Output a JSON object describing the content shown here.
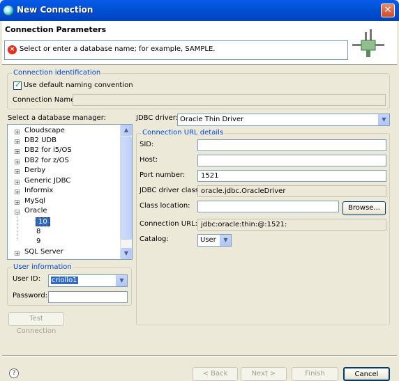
{
  "window": {
    "title": "New Connection",
    "close_glyph": "✕"
  },
  "header": {
    "title": "Connection Parameters",
    "message": "Select or enter a database name; for example, SAMPLE.",
    "message_icon": "error-icon"
  },
  "connection_identification": {
    "legend": "Connection identification",
    "use_default_label": "Use default naming convention",
    "use_default_checked": true,
    "name_label": "Connection Name:",
    "name_value": ""
  },
  "db_manager": {
    "label": "Select a database manager:",
    "items": [
      {
        "label": "Cloudscape",
        "expander": "+"
      },
      {
        "label": "DB2 UDB",
        "expander": "+"
      },
      {
        "label": "DB2 for i5/OS",
        "expander": "+"
      },
      {
        "label": "DB2 for z/OS",
        "expander": "+"
      },
      {
        "label": "Derby",
        "expander": "+"
      },
      {
        "label": "Generic JDBC",
        "expander": "+"
      },
      {
        "label": "Informix",
        "expander": "+"
      },
      {
        "label": "MySql",
        "expander": "+"
      },
      {
        "label": "Oracle",
        "expander": "−"
      },
      {
        "label": "10",
        "expander": ""
      },
      {
        "label": "8",
        "expander": ""
      },
      {
        "label": "9",
        "expander": ""
      },
      {
        "label": "SQL Server",
        "expander": "+"
      }
    ],
    "selected": "10"
  },
  "jdbc": {
    "driver_label": "JDBC driver:",
    "driver_value": "Oracle Thin Driver",
    "url_group_legend": "Connection URL details",
    "sid_label": "SID:",
    "sid_value": "",
    "host_label": "Host:",
    "host_value": "",
    "port_label": "Port number:",
    "port_value": "1521",
    "class_label": "JDBC driver class:",
    "class_value": "oracle.jdbc.OracleDriver",
    "location_label": "Class location:",
    "location_value": "",
    "browse_label": "Browse...",
    "url_label": "Connection URL:",
    "url_value": "jdbc:oracle:thin:@:1521:",
    "catalog_label": "Catalog:",
    "catalog_value": "User"
  },
  "user_info": {
    "legend": "User information",
    "userid_label": "User ID:",
    "userid_value": "criollo1",
    "password_label": "Password:",
    "password_value": ""
  },
  "test_connection_label": "Test Connection",
  "footer": {
    "back_label": "< Back",
    "next_label": "Next >",
    "finish_label": "Finish",
    "cancel_label": "Cancel",
    "help_glyph": "?"
  }
}
